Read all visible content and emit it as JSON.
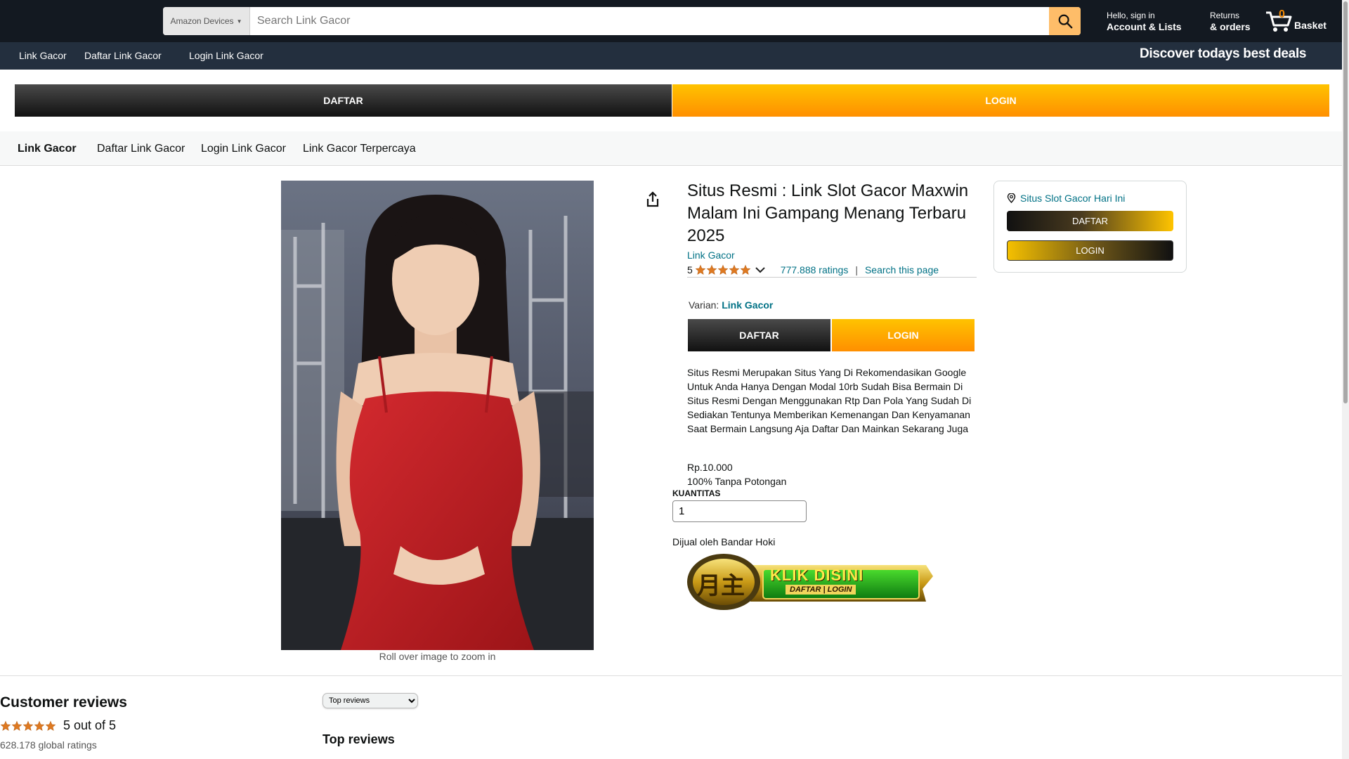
{
  "header": {
    "search_category": "Amazon Devices",
    "search_placeholder": "Search Link Gacor",
    "account_greeting": "Hello, sign in",
    "account_label": "Account & Lists",
    "returns_label": "Returns",
    "orders_label": "& orders",
    "cart_count": "0",
    "cart_label": "Basket"
  },
  "subnav": {
    "items": [
      "Link Gacor",
      "Daftar Link Gacor",
      "Login Link Gacor"
    ],
    "deals": "Discover todays best deals"
  },
  "top_buttons": {
    "daftar": "DAFTAR",
    "login": "LOGIN"
  },
  "category_nav": {
    "items": [
      "Link Gacor",
      "Daftar Link Gacor",
      "Login Link Gacor",
      "Link Gacor Terpercaya"
    ]
  },
  "product": {
    "image_caption": "Roll over image to zoom in",
    "title": "Situs Resmi : Link Slot Gacor Maxwin Malam Ini Gampang Menang Terbaru 2025",
    "store": "Link Gacor",
    "rating_value": "5",
    "rating_stars": 5,
    "ratings_count": "777.888 ratings",
    "separator": "|",
    "search_page": "Search this page",
    "varian_label": "Varian:",
    "varian_value": "Link Gacor",
    "buttons": {
      "daftar": "DAFTAR",
      "login": "LOGIN"
    },
    "description": "Situs Resmi Merupakan Situs Yang Di Rekomendasikan Google Untuk Anda Hanya Dengan Modal 10rb Sudah Bisa Bermain Di Situs Resmi Dengan Menggunakan Rtp Dan Pola Yang Sudah Di Sediakan Tentunya Memberikan Kemenangan Dan Kenyamanan Saat Bermain Langsung Aja Daftar Dan Mainkan Sekarang Juga",
    "price": "Rp.10.000",
    "price_note": "100% Tanpa Potongan",
    "quantity_label": "KUANTITAS",
    "quantity_value": "1",
    "seller": "Dijual oleh Bandar Hoki",
    "banner_text": "KLIK DISINI",
    "banner_subtext": "DAFTAR | LOGIN",
    "banner_logo": "月主"
  },
  "buybox": {
    "location": "Situs Slot Gacor Hari Ini",
    "daftar": "DAFTAR",
    "login": "LOGIN"
  },
  "reviews": {
    "title": "Customer reviews",
    "stars": 5,
    "score": "5 out of 5",
    "global": "628.178 global ratings",
    "sort_selected": "Top reviews",
    "top_reviews": "Top reviews"
  },
  "colors": {
    "header_bg": "#131921",
    "subnav_bg": "#232f3e",
    "search_button": "#febd69",
    "link": "#007185",
    "gold": "#ffb300",
    "star": "#de7921"
  }
}
